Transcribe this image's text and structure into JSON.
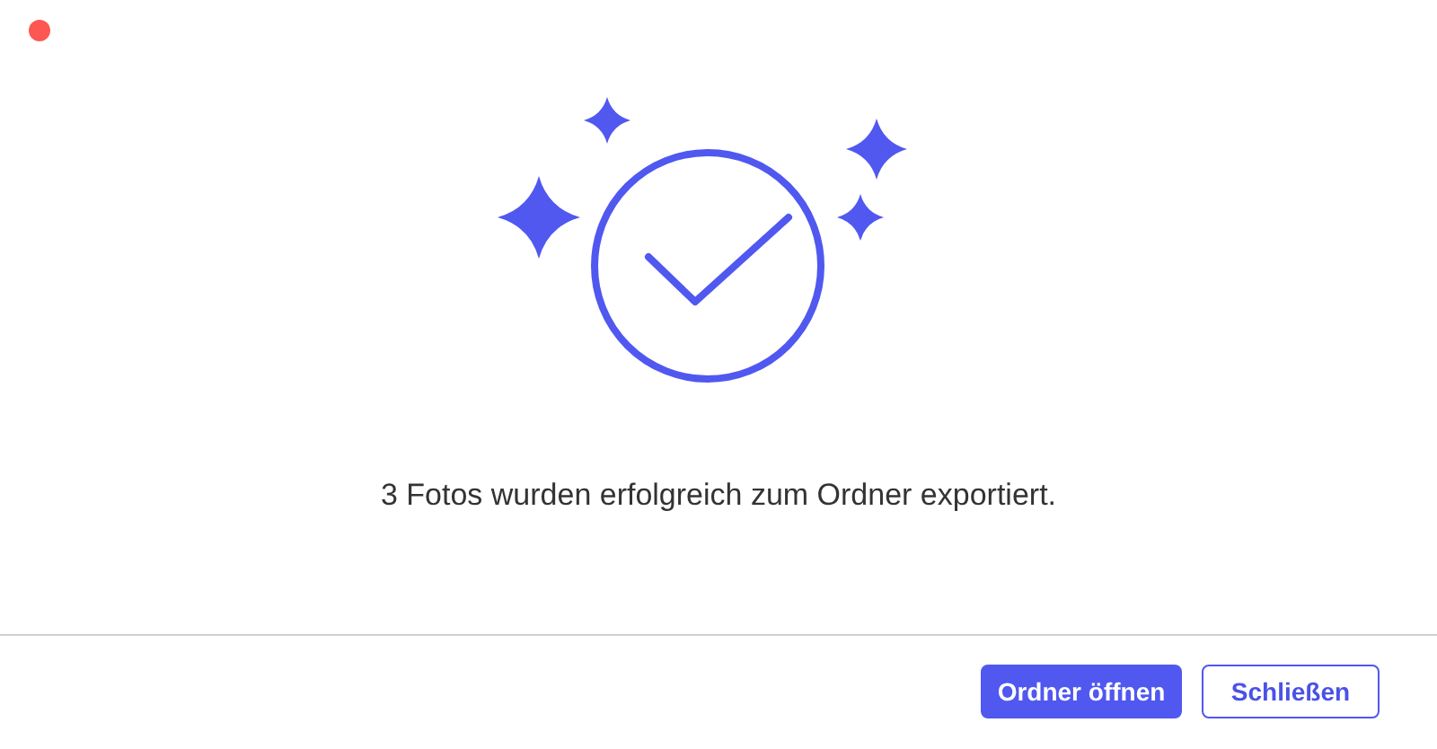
{
  "message": "3 Fotos wurden erfolgreich zum Ordner exportiert.",
  "buttons": [
    {
      "label": "Ordner öffnen",
      "kind": "primary"
    },
    {
      "label": "Schließen",
      "kind": "secondary"
    }
  ]
}
